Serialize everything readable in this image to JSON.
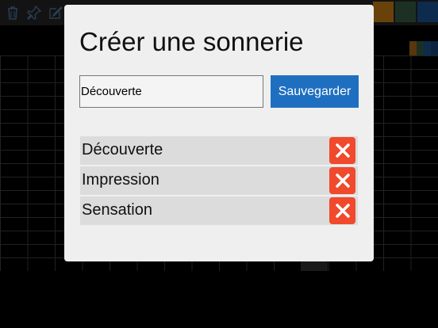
{
  "dialog": {
    "title": "Créer une sonnerie",
    "name_input": {
      "value": "Découverte",
      "placeholder": ""
    },
    "save_label": "Sauvegarder",
    "ringtones": [
      {
        "label": "Découverte"
      },
      {
        "label": "Impression"
      },
      {
        "label": "Sensation"
      }
    ]
  },
  "toolbar": {
    "icons": [
      "trash-icon",
      "pin-icon",
      "edit-icon"
    ],
    "swatch_colors": [
      "#e8931a",
      "#3f6e4e",
      "#1e5fa8"
    ]
  },
  "colors": {
    "accent": "#1f6fc0",
    "delete": "#f0492c",
    "dialog_bg": "#efefef",
    "list_item_bg": "#dcdcdc"
  }
}
